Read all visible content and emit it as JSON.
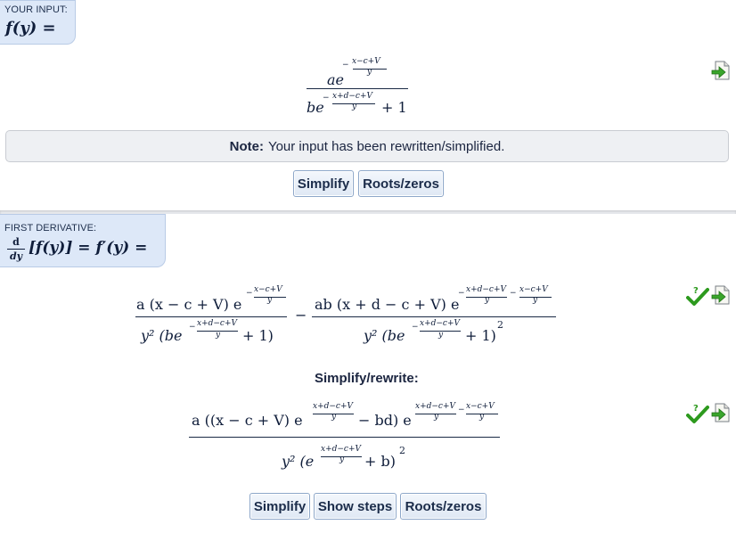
{
  "input_section": {
    "caption": "YOUR INPUT:",
    "function_label": "f(y) =",
    "expression": {
      "num_coef": "ae",
      "num_exp": "x−c+V",
      "num_exp_den": "y",
      "den_coef": "be",
      "den_exp": "x+d−c+V",
      "den_exp_den": "y",
      "den_tail": "+ 1"
    },
    "note_bold": "Note:",
    "note_text": "Your input has been rewritten/simplified.",
    "buttons": [
      "Simplify",
      "Roots/zeros"
    ]
  },
  "derivative_section": {
    "caption": "FIRST DERIVATIVE:",
    "label_d": "d",
    "label_dy": "dy",
    "label_rest": "[f(y)] = f′(y) =",
    "term1": {
      "numerator": "a (x − c + V) e",
      "num_exp": "x−c+V",
      "num_exp_den": "y",
      "den_y": "y² (be",
      "den_exp": "x+d−c+V",
      "den_exp_den": "y",
      "den_tail": "+ 1)"
    },
    "minus": "−",
    "term2": {
      "numerator": "ab (x + d − c + V) e",
      "num_exp_a": "x+d−c+V",
      "num_exp_b": "x−c+V",
      "num_exp_den": "y",
      "den_y": "y² (be",
      "den_exp": "x+d−c+V",
      "den_exp_den": "y",
      "den_tail": "+ 1)",
      "den_power": "2"
    },
    "simplify_heading": "Simplify/rewrite:",
    "simplified": {
      "num_a": "a ((x − c + V) e",
      "num_exp1": "x+d−c+V",
      "num_mid": "− bd) e",
      "num_exp2a": "x+d−c+V",
      "num_exp2b": "x−c+V",
      "exp_den": "y",
      "den_a": "y² (e",
      "den_exp": "x+d−c+V",
      "den_tail": "+ b)",
      "den_power": "2"
    },
    "buttons": [
      "Simplify",
      "Show steps",
      "Roots/zeros"
    ]
  },
  "icons": {
    "export": "export-icon",
    "check": "check-icon"
  },
  "colors": {
    "tag_bg": "#dde8f8",
    "check_green": "#2d9a1e",
    "arrow_green": "#3aa52b"
  }
}
